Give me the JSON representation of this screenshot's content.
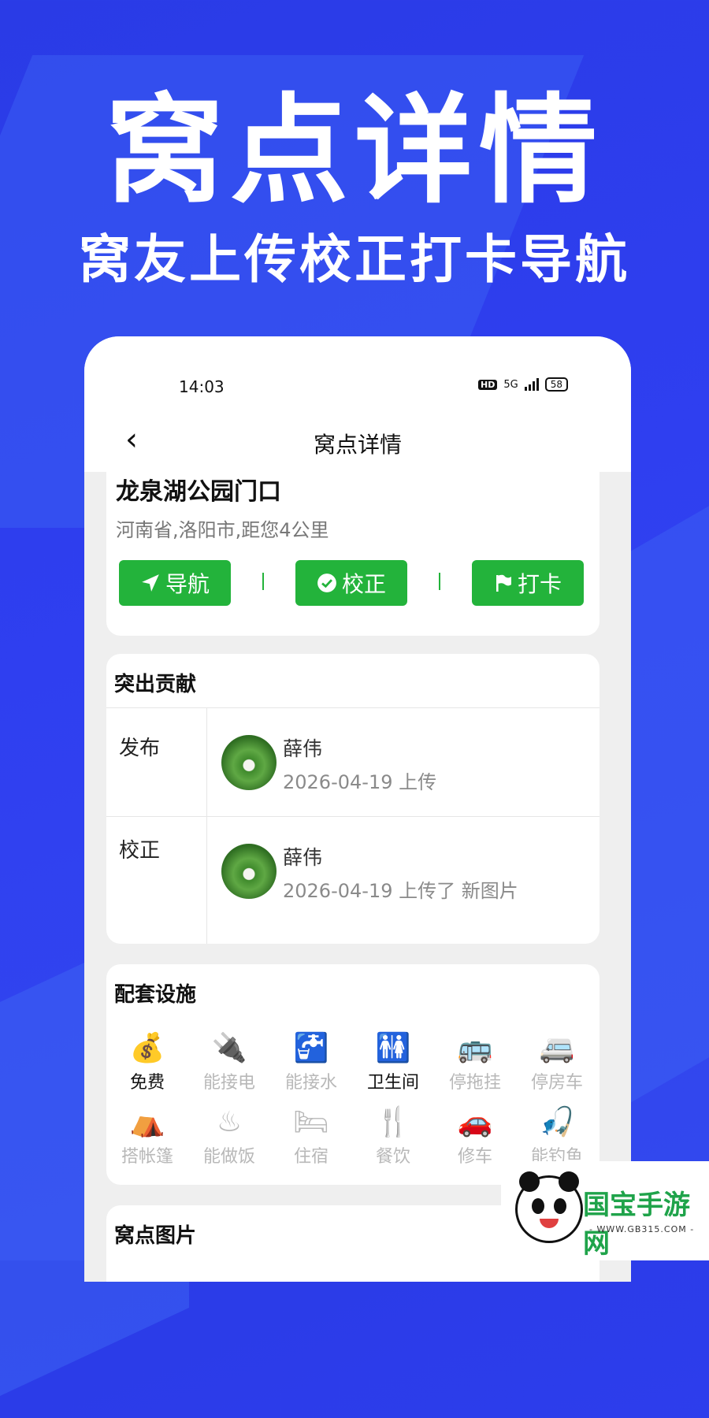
{
  "hero": {
    "title": "窝点详情",
    "subtitle": "窝友上传校正打卡导航"
  },
  "status_bar": {
    "time": "14:03",
    "hd": "HD",
    "network": "5G",
    "battery": "58"
  },
  "nav": {
    "title": "窝点详情",
    "back_icon": "chevron-left-icon"
  },
  "spot": {
    "name": "龙泉湖公园门口",
    "address": "河南省,洛阳市,距您4公里"
  },
  "actions": [
    {
      "label": "导航",
      "icon": "send-icon"
    },
    {
      "label": "校正",
      "icon": "check-circle-icon"
    },
    {
      "label": "打卡",
      "icon": "flag-icon"
    }
  ],
  "contributions": {
    "title": "突出贡献",
    "rows": [
      {
        "label": "发布",
        "user": "薛伟",
        "desc": "2026-04-19 上传"
      },
      {
        "label": "校正",
        "user": "薛伟",
        "desc": "2026-04-19 上传了 新图片"
      }
    ]
  },
  "facilities": {
    "title": "配套设施",
    "items": [
      {
        "label": "免费",
        "icon": "money-bag-icon",
        "active": true
      },
      {
        "label": "能接电",
        "icon": "plug-icon",
        "active": false
      },
      {
        "label": "能接水",
        "icon": "faucet-icon",
        "active": false
      },
      {
        "label": "卫生间",
        "icon": "restroom-icon",
        "active": true
      },
      {
        "label": "停拖挂",
        "icon": "trailer-icon",
        "active": false
      },
      {
        "label": "停房车",
        "icon": "rv-icon",
        "active": false
      },
      {
        "label": "搭帐篷",
        "icon": "tent-icon",
        "active": false
      },
      {
        "label": "能做饭",
        "icon": "pot-icon",
        "active": false
      },
      {
        "label": "住宿",
        "icon": "bed-icon",
        "active": false
      },
      {
        "label": "餐饮",
        "icon": "utensils-icon",
        "active": false
      },
      {
        "label": "修车",
        "icon": "car-icon",
        "active": false
      },
      {
        "label": "能钓鱼",
        "icon": "fishing-icon",
        "active": false
      }
    ]
  },
  "photos": {
    "title": "窝点图片"
  },
  "watermark": {
    "name": "国宝手游网",
    "url": "- WWW.GB315.COM -"
  }
}
